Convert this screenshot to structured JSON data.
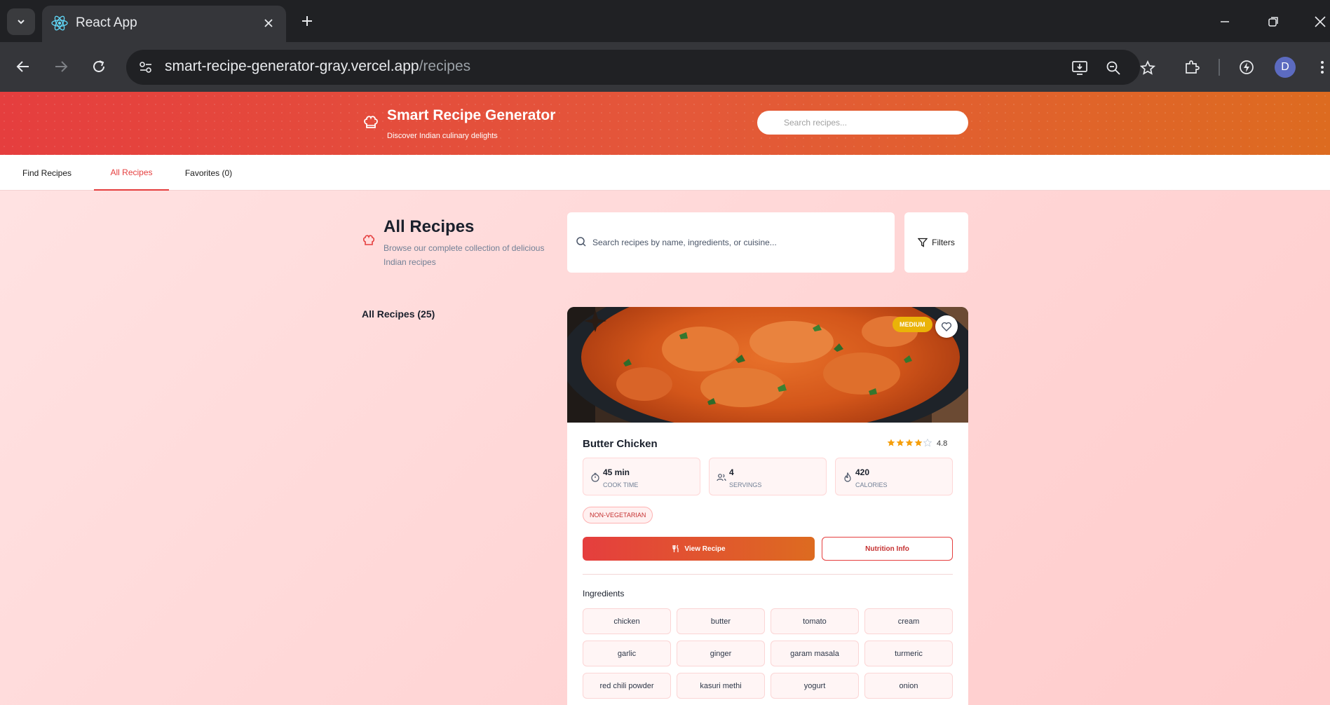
{
  "browser": {
    "tab_title": "React App",
    "url_host": "smart-recipe-generator-gray.vercel.app",
    "url_path": "/recipes",
    "profile_initial": "D"
  },
  "header": {
    "title": "Smart Recipe Generator",
    "subtitle": "Discover Indian culinary delights",
    "search_placeholder": "Search recipes..."
  },
  "nav": {
    "tabs": [
      {
        "label": "Find Recipes",
        "active": false
      },
      {
        "label": "All Recipes",
        "active": true
      },
      {
        "label": "Favorites (0)",
        "active": false
      }
    ]
  },
  "main": {
    "title": "All Recipes",
    "subtitle": "Browse our complete collection of delicious Indian recipes",
    "search_placeholder": "Search recipes by name, ingredients, or cuisine...",
    "filters_label": "Filters",
    "count_label": "All Recipes (25)"
  },
  "recipe": {
    "difficulty": "MEDIUM",
    "name": "Butter Chicken",
    "rating": "4.8",
    "stars_filled": 4,
    "stars_total": 5,
    "stats": [
      {
        "value": "45 min",
        "label": "COOK TIME",
        "icon": "timer-icon"
      },
      {
        "value": "4",
        "label": "SERVINGS",
        "icon": "users-icon"
      },
      {
        "value": "420",
        "label": "CALORIES",
        "icon": "flame-icon"
      }
    ],
    "diet_badge": "NON-VEGETARIAN",
    "view_label": "View Recipe",
    "nutrition_label": "Nutrition Info",
    "ingredients_title": "Ingredients",
    "ingredients": [
      "chicken",
      "butter",
      "tomato",
      "cream",
      "garlic",
      "ginger",
      "garam masala",
      "turmeric",
      "red chili powder",
      "kasuri methi",
      "yogurt",
      "onion"
    ]
  },
  "colors": {
    "accent": "#e53e3e",
    "accent_end": "#dd6b20",
    "difficulty_badge": "#eab308",
    "star": "#f59e0b"
  }
}
